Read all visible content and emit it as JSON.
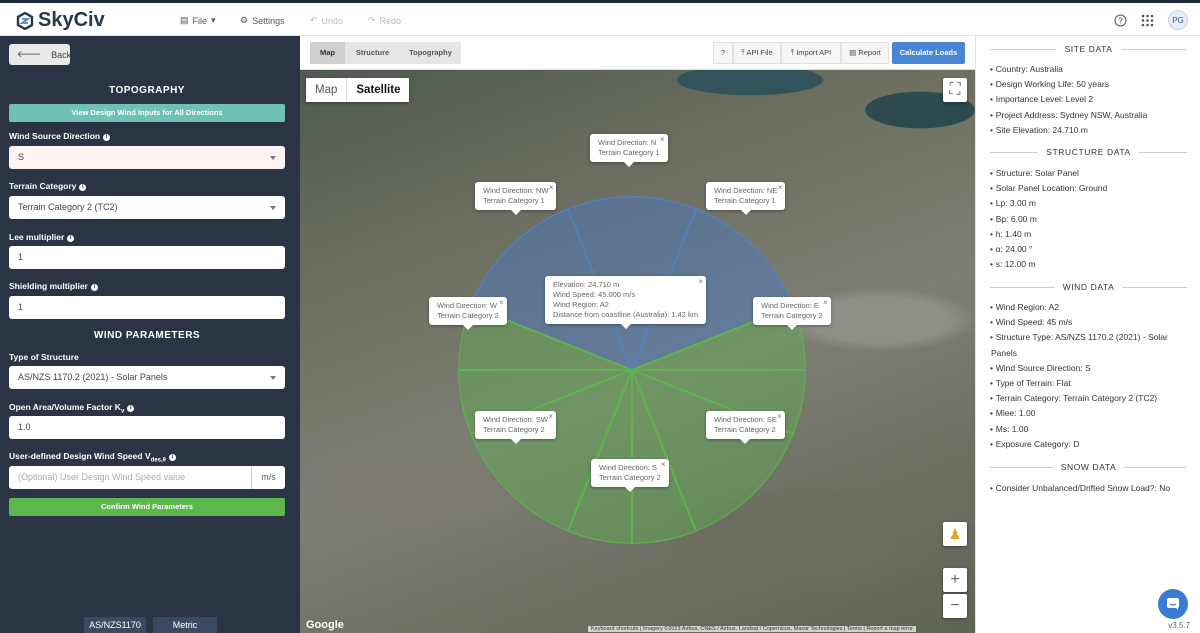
{
  "app": {
    "name": "SkyCiv"
  },
  "topbar": {
    "file": "File",
    "settings": "Settings",
    "undo": "Undo",
    "redo": "Redo",
    "avatar": "PG"
  },
  "left": {
    "back": "Back",
    "topography_title": "TOPOGRAPHY",
    "view_design_btn": "View Design Wind Inputs for All Directions",
    "wind_source_direction": {
      "label": "Wind Source Direction",
      "value": "S"
    },
    "terrain_category": {
      "label": "Terrain Category",
      "value": "Terrain Category 2 (TC2)"
    },
    "lee_multiplier": {
      "label": "Lee multiplier",
      "value": "1"
    },
    "shielding_multiplier": {
      "label": "Shielding multiplier",
      "value": "1"
    },
    "wind_parameters_title": "WIND PARAMETERS",
    "structure_type": {
      "label": "Type of Structure",
      "value": "AS/NZS 1170.2 (2021) - Solar Panels"
    },
    "open_area_factor": {
      "label": "Open Area/Volume Factor K",
      "sub": "v",
      "value": "1.0"
    },
    "design_wind_speed": {
      "label": "User-defined Design Wind Speed V",
      "sub": "des,θ",
      "placeholder": "(Optional) User Design Wind Speed value",
      "unit": "m/s"
    },
    "confirm_btn": "Confirm Wind Parameters",
    "footer_tabs": [
      "AS/NZS1170",
      "Metric"
    ]
  },
  "map": {
    "tabs": [
      "Map",
      "Structure",
      "Topography"
    ],
    "help": "?",
    "api_file": "API File",
    "import_api": "Import API",
    "report": "Report",
    "calculate": "Calculate Loads",
    "maptype": [
      "Map",
      "Satellite"
    ],
    "center_info": [
      "Elevation: 24.710 m",
      "Wind Speed: 45.000 m/s",
      "Wind Region: A2",
      "Distance from coastline (Australia): 1.42 km"
    ],
    "directions": [
      {
        "dir": "Wind Direction: N",
        "cat": "Terrain Category 1"
      },
      {
        "dir": "Wind Direction: NW",
        "cat": "Terrain Category 1"
      },
      {
        "dir": "Wind Direction: NE",
        "cat": "Terrain Category 1"
      },
      {
        "dir": "Wind Direction: W",
        "cat": "Terrain Category 2"
      },
      {
        "dir": "Wind Direction: E",
        "cat": "Terrain Category 2"
      },
      {
        "dir": "Wind Direction: SW",
        "cat": "Terrain Category 2"
      },
      {
        "dir": "Wind Direction: SE",
        "cat": "Terrain Category 2"
      },
      {
        "dir": "Wind Direction: S",
        "cat": "Terrain Category 2"
      }
    ],
    "google": "Google",
    "attribution": "Keyboard shortcuts | Imagery ©2023 Airbus, CNES / Airbus, Landsat / Copernicus, Maxar Technologies | Terms | Report a map error",
    "colors": {
      "cat1": "#4a86d4",
      "cat2": "#5cb74c"
    }
  },
  "right": {
    "site_title": "SITE DATA",
    "site": [
      "Country: Australia",
      "Design Working Life: 50 years",
      "Importance Level: Level 2",
      "Project Address: Sydney NSW, Australia",
      "Site Elevation: 24.710 m"
    ],
    "structure_title": "STRUCTURE DATA",
    "structure": [
      "Structure: Solar Panel",
      "Solar Panel Location: Ground",
      "Lp: 3.00 m",
      "Bp: 6.00 m",
      "h: 1.40 m",
      "α: 24.00 °",
      "s: 12.00 m"
    ],
    "wind_title": "WIND DATA",
    "wind": [
      "Wind Region: A2",
      "Wind Speed: 45 m/s",
      "Structure Type: AS/NZS 1170.2 (2021) - Solar Panels",
      "Wind Source Direction: S",
      "Type of Terrain: Flat",
      "Terrain Category: Terrain Category 2 (TC2)",
      "Mlee: 1.00",
      "Ms: 1.00",
      "Exposure Category: D"
    ],
    "snow_title": "SNOW DATA",
    "snow": [
      "Consider Unbalanced/Drifted Snow Load?: No"
    ],
    "version": "v3.5.7"
  }
}
